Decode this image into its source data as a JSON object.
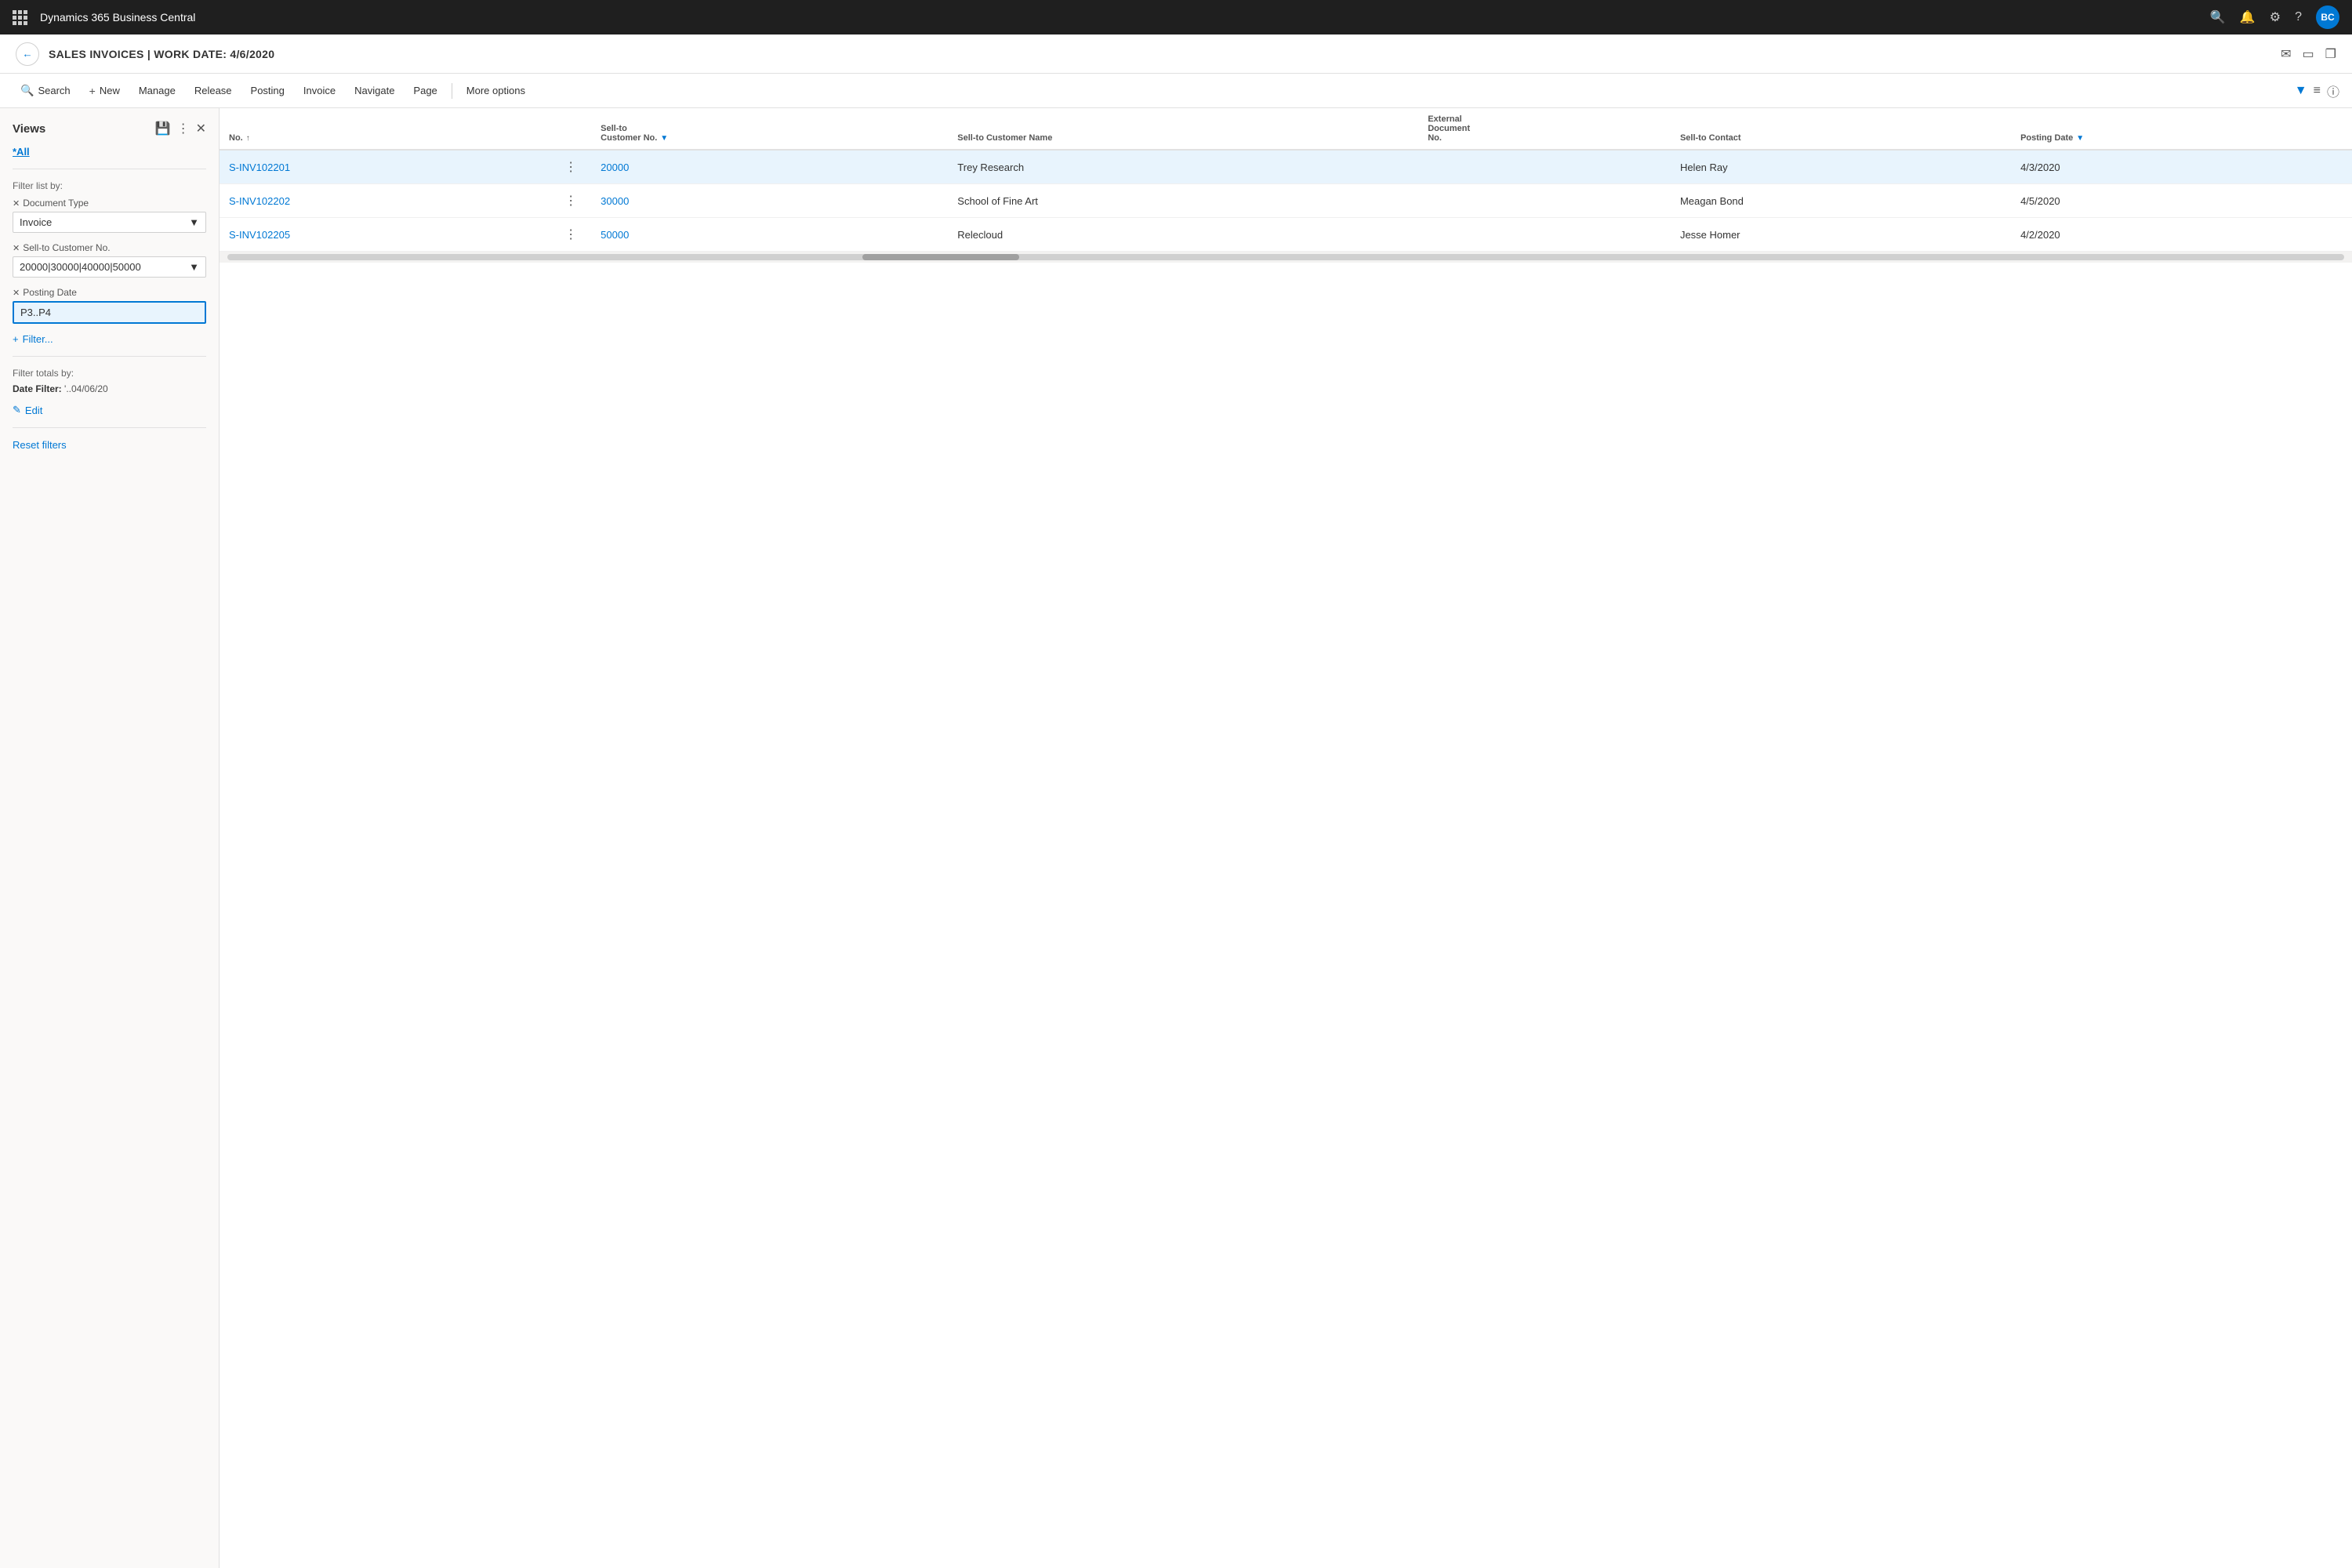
{
  "app": {
    "title": "Dynamics 365 Business Central",
    "avatar": "BC"
  },
  "page": {
    "title": "SALES INVOICES | WORK DATE: 4/6/2020",
    "breadcrumb": "Sales Invoices"
  },
  "toolbar": {
    "search_label": "Search",
    "new_label": "New",
    "manage_label": "Manage",
    "release_label": "Release",
    "posting_label": "Posting",
    "invoice_label": "Invoice",
    "navigate_label": "Navigate",
    "page_label": "Page",
    "more_options_label": "More options"
  },
  "views": {
    "title": "Views",
    "current_view": "*All"
  },
  "filters": {
    "filter_list_label": "Filter list by:",
    "document_type": {
      "label": "Document Type",
      "value": "Invoice"
    },
    "sell_to_customer_no": {
      "label": "Sell-to Customer No.",
      "value": "20000|30000|40000|50000"
    },
    "posting_date": {
      "label": "Posting Date",
      "value": "P3..P4"
    },
    "add_filter_label": "Filter...",
    "filter_totals_label": "Filter totals by:",
    "date_filter_label": "Date Filter:",
    "date_filter_value": "'..04/06/20",
    "edit_label": "Edit",
    "reset_filters_label": "Reset filters"
  },
  "table": {
    "columns": [
      {
        "id": "no",
        "label": "No.",
        "sortable": true,
        "filterable": false
      },
      {
        "id": "options",
        "label": "",
        "sortable": false,
        "filterable": false
      },
      {
        "id": "sell_to_customer_no",
        "label": "Sell-to\nCustomer No.",
        "sortable": false,
        "filterable": true
      },
      {
        "id": "sell_to_customer_name",
        "label": "Sell-to Customer Name",
        "sortable": false,
        "filterable": false
      },
      {
        "id": "external_document_no",
        "label": "External\nDocument\nNo.",
        "sortable": false,
        "filterable": false
      },
      {
        "id": "sell_to_contact",
        "label": "Sell-to Contact",
        "sortable": false,
        "filterable": false
      },
      {
        "id": "posting_date",
        "label": "Posting Date",
        "sortable": false,
        "filterable": true
      }
    ],
    "rows": [
      {
        "id": "row-1",
        "selected": true,
        "no": "S-INV102201",
        "sell_to_customer_no": "20000",
        "sell_to_customer_name": "Trey Research",
        "external_document_no": "",
        "sell_to_contact": "Helen Ray",
        "posting_date": "4/3/2020"
      },
      {
        "id": "row-2",
        "selected": false,
        "no": "S-INV102202",
        "sell_to_customer_no": "30000",
        "sell_to_customer_name": "School of Fine Art",
        "external_document_no": "",
        "sell_to_contact": "Meagan Bond",
        "posting_date": "4/5/2020"
      },
      {
        "id": "row-3",
        "selected": false,
        "no": "S-INV102205",
        "sell_to_customer_no": "50000",
        "sell_to_customer_name": "Relecloud",
        "external_document_no": "",
        "sell_to_contact": "Jesse Homer",
        "posting_date": "4/2/2020"
      }
    ]
  }
}
